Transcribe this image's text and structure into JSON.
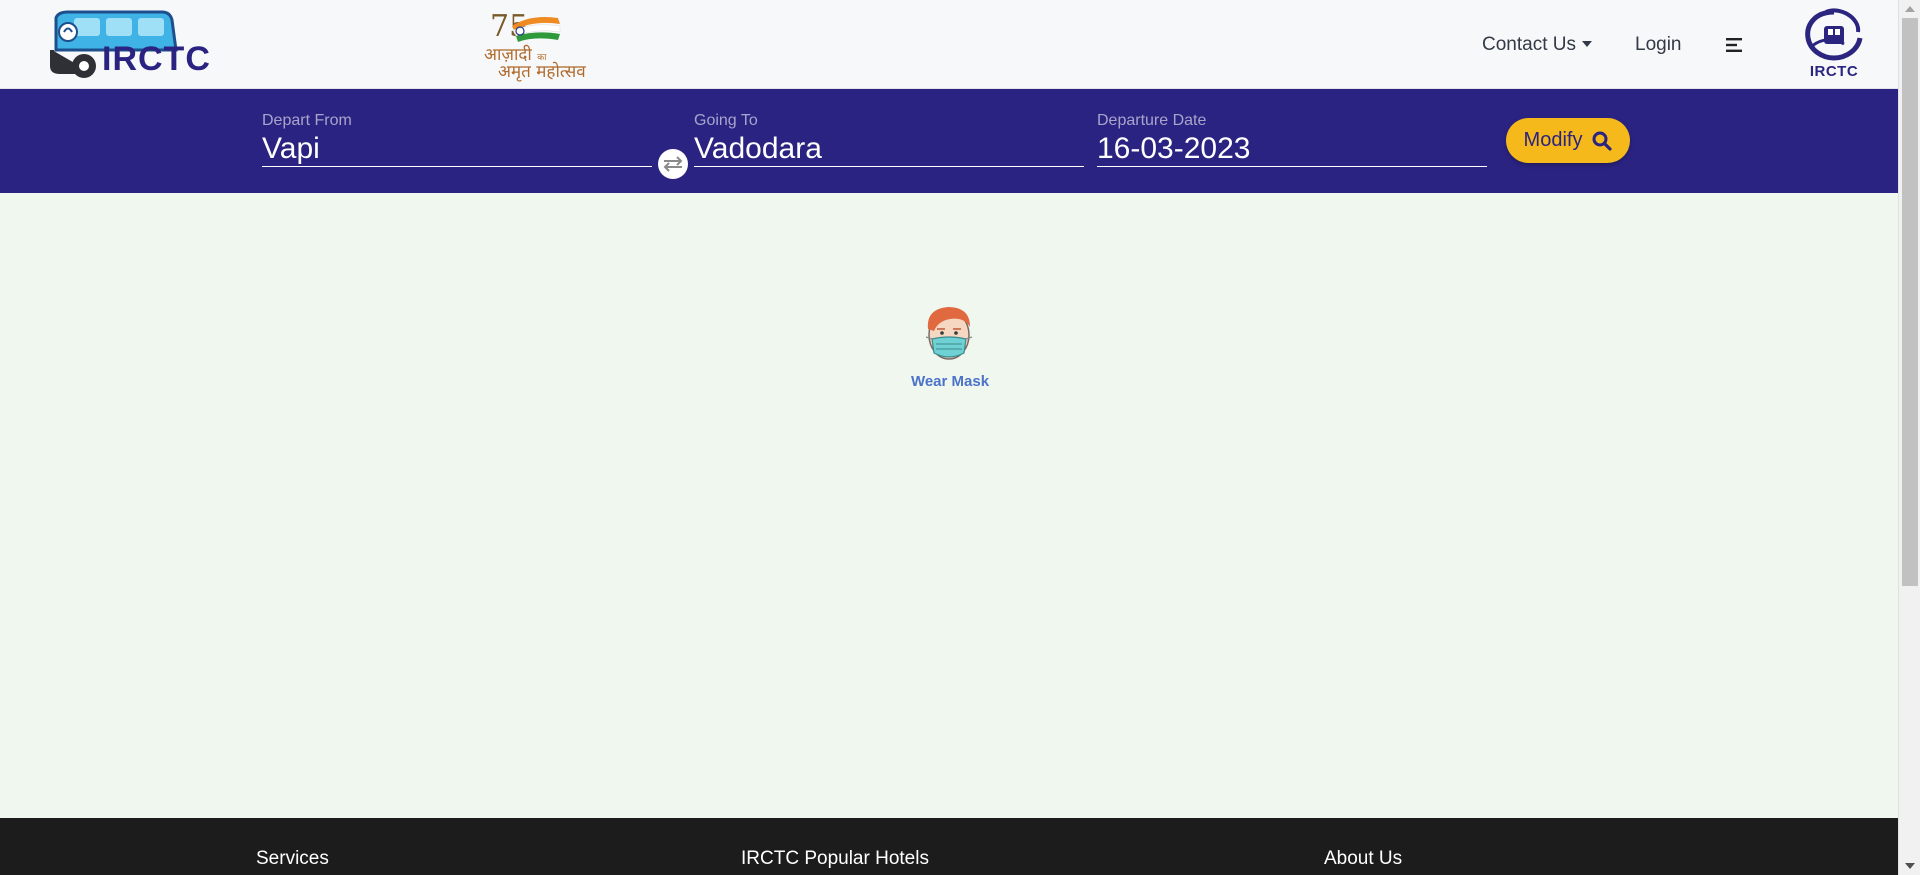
{
  "header": {
    "logo_text": "IRCTC",
    "amrit_logo": {
      "numeral": "75",
      "line1": "आज़ादी",
      "line1_small": "का",
      "line2": "अमृत महोत्सव"
    },
    "nav": {
      "contact_label": "Contact Us",
      "login_label": "Login",
      "menu_icon": "menu-align-left-icon"
    },
    "emblem_text": "IRCTC"
  },
  "search": {
    "from": {
      "label": "Depart From",
      "value": "Vapi"
    },
    "to": {
      "label": "Going To",
      "value": "Vadodara"
    },
    "date": {
      "label": "Departure Date",
      "value": "16-03-2023"
    },
    "swap_icon": "swap-arrows-icon",
    "modify_label": "Modify",
    "modify_icon": "search-icon"
  },
  "main": {
    "caption": "Wear Mask"
  },
  "footer": {
    "headings": {
      "services": "Services",
      "hotels": "IRCTC Popular Hotels",
      "about": "About Us"
    }
  },
  "colors": {
    "header_bg": "#f7f8fa",
    "search_band": "#2b2381",
    "modify_button": "#f6b91b",
    "page_bg": "#f0f7ef",
    "footer_bg": "#1c1c1c",
    "caption_blue": "#4a73c9"
  }
}
